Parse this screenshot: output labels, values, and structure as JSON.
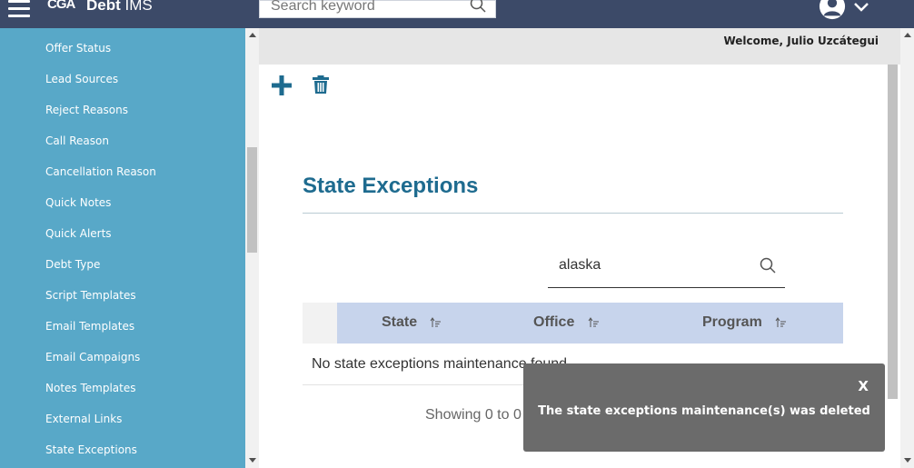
{
  "header": {
    "logo_mark": "CGA",
    "app_name_bold": "Debt",
    "app_name_rest": " IMS",
    "search_placeholder": "Search keyword"
  },
  "sidebar": {
    "items": [
      {
        "label": "Offer Status"
      },
      {
        "label": "Lead Sources"
      },
      {
        "label": "Reject Reasons"
      },
      {
        "label": "Call Reason"
      },
      {
        "label": "Cancellation Reason"
      },
      {
        "label": "Quick Notes"
      },
      {
        "label": "Quick Alerts"
      },
      {
        "label": "Debt Type"
      },
      {
        "label": "Script Templates"
      },
      {
        "label": "Email Templates"
      },
      {
        "label": "Email Campaigns"
      },
      {
        "label": "Notes Templates"
      },
      {
        "label": "External Links"
      },
      {
        "label": "State Exceptions"
      }
    ]
  },
  "welcome": "Welcome, Julio Uzcátegui",
  "page": {
    "title": "State Exceptions",
    "filter_value": "alaska",
    "columns": [
      "State",
      "Office",
      "Program"
    ],
    "empty_message": "No state exceptions maintenance found",
    "showing": "Showing 0 to 0"
  },
  "toast": {
    "close_label": "X",
    "message": "The state exceptions maintenance(s) was deleted"
  },
  "colors": {
    "topbar": "#3c4a68",
    "sidebar": "#58a8c8",
    "accent": "#1e6b8f",
    "table_header": "#c7d4ec",
    "toast": "#6b6b6b"
  },
  "icons": {
    "menu": "hamburger-icon",
    "search": "search-icon",
    "user": "user-icon",
    "chevron": "chevron-down-icon",
    "add": "plus-icon",
    "delete": "trash-icon",
    "sort": "sort-icon"
  }
}
